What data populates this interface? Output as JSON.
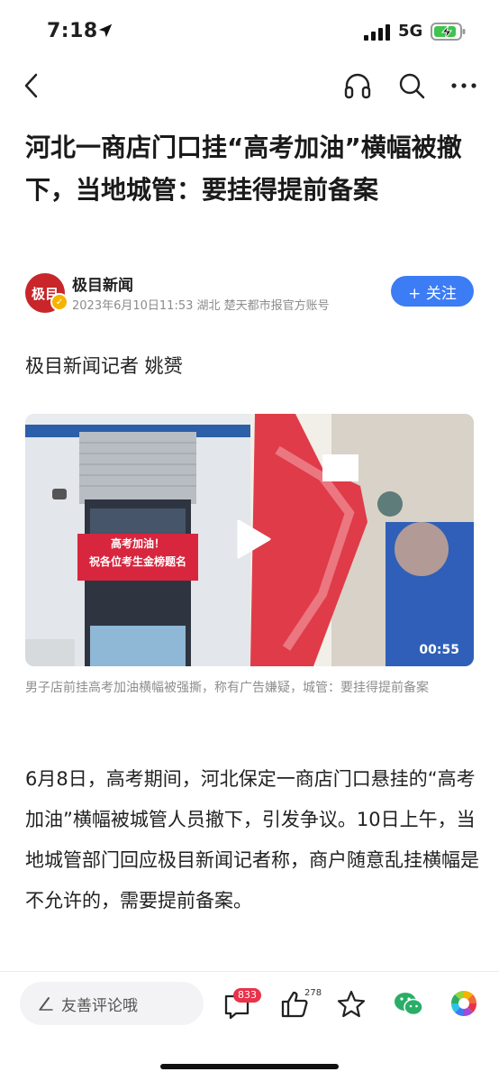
{
  "status": {
    "time": "7:18",
    "network": "5G"
  },
  "article": {
    "title": "河北一商店门口挂“高考加油”横幅被撤下，当地城管：要挂得提前备案",
    "author": {
      "avatar_text": "极目",
      "name": "极目新闻",
      "meta": "2023年6月10日11:53 湖北 楚天都市报官方账号",
      "follow_label": "+ 关注"
    },
    "reporter": "极目新闻记者 姚赟",
    "video": {
      "banner_line1": "高考加油！",
      "banner_line2": "祝各位考生金榜题名",
      "duration": "00:55"
    },
    "caption": "男子店前挂高考加油横幅被强撕，称有广告嫌疑，城管：要挂得提前备案",
    "paragraph": "6月8日，高考期间，河北保定一商店门口悬挂的“高考加油”横幅被城管人员撤下，引发争议。10日上午，当地城管部门回应极目新闻记者称，商户随意乱挂横幅是不允许的，需要提前备案。"
  },
  "bottom_bar": {
    "comment_placeholder": "友善评论哦",
    "comment_count": "833",
    "like_count": "278"
  },
  "colors": {
    "accent": "#3c7cf4",
    "brand": "#c8262a",
    "badge": "#e8334a",
    "wechat": "#2aae67"
  }
}
